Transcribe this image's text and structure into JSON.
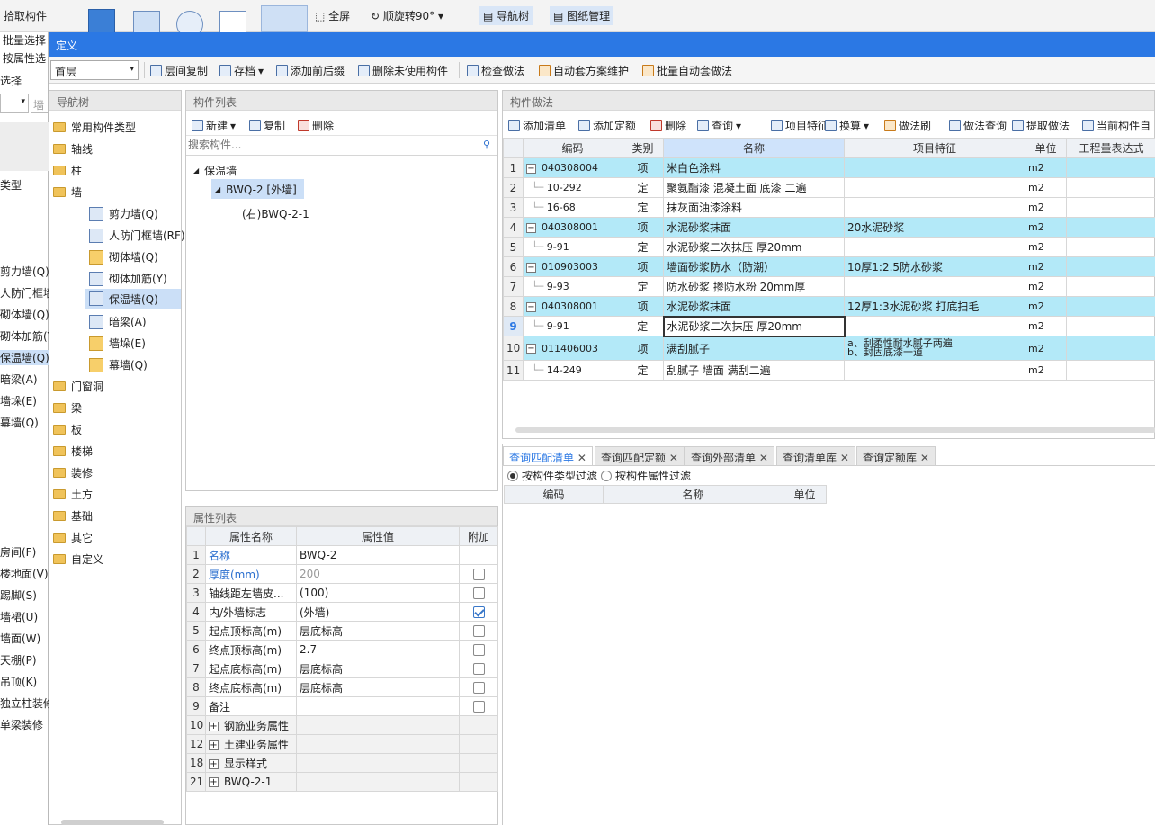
{
  "ribbon": {
    "pick_component": "拾取构件",
    "batch_select": "批量选择",
    "select_by_attr": "按属性选",
    "select": "选择",
    "fullscreen": "全屏",
    "rotate_cw": "顺旋转90°",
    "nav_tree": "导航树",
    "drawing_mgmt": "图纸管理"
  },
  "left_strip": {
    "combo_text": "墙",
    "type_label": "类型",
    "items": [
      "剪力墙(Q)",
      "人防门框墙",
      "砌体墙(Q)",
      "砌体加筋(Y",
      "保温墙(Q)",
      "暗梁(A)",
      "墙垛(E)",
      "幕墙(Q)"
    ],
    "items2": [
      "房间(F)",
      "楼地面(V)",
      "踢脚(S)",
      "墙裙(U)",
      "墙面(W)",
      "天棚(P)",
      "吊顶(K)",
      "独立柱装修",
      "单梁装修"
    ]
  },
  "title": "定义",
  "toolbar": {
    "floor": "首层",
    "floor_copy": "层间复制",
    "save": "存档",
    "add_prefix_suffix": "添加前后缀",
    "delete_unused": "删除未使用构件",
    "check_method": "检查做法",
    "auto_plan": "自动套方案维护",
    "batch_auto": "批量自动套做法"
  },
  "nav_tree": {
    "title": "导航树",
    "items": [
      {
        "label": "常用构件类型"
      },
      {
        "label": "轴线"
      },
      {
        "label": "柱"
      },
      {
        "label": "墙"
      }
    ],
    "wall_children": [
      "剪力墙(Q)",
      "人防门框墙(RF)",
      "砌体墙(Q)",
      "砌体加筋(Y)",
      "保温墙(Q)",
      "暗梁(A)",
      "墙垛(E)",
      "幕墙(Q)"
    ],
    "items_after": [
      "门窗洞",
      "梁",
      "板",
      "楼梯",
      "装修",
      "土方",
      "基础",
      "其它",
      "自定义"
    ]
  },
  "component_list": {
    "title": "构件列表",
    "new": "新建",
    "copy": "复制",
    "delete": "删除",
    "search_placeholder": "搜索构件...",
    "root": "保温墙",
    "child": "BWQ-2 [外墙]",
    "grandchild": "(右)BWQ-2-1"
  },
  "property_list": {
    "title": "属性列表",
    "headers": [
      "属性名称",
      "属性值",
      "附加"
    ],
    "rows": [
      {
        "no": "1",
        "name": "名称",
        "value": "BWQ-2",
        "check": "none"
      },
      {
        "no": "2",
        "name": "厚度(mm)",
        "value": "200",
        "check": "off"
      },
      {
        "no": "3",
        "name": "轴线距左墙皮...",
        "value": "(100)",
        "check": "off"
      },
      {
        "no": "4",
        "name": "内/外墙标志",
        "value": "(外墙)",
        "check": "on"
      },
      {
        "no": "5",
        "name": "起点顶标高(m)",
        "value": "层底标高",
        "check": "off"
      },
      {
        "no": "6",
        "name": "终点顶标高(m)",
        "value": "2.7",
        "check": "off"
      },
      {
        "no": "7",
        "name": "起点底标高(m)",
        "value": "层底标高",
        "check": "off"
      },
      {
        "no": "8",
        "name": "终点底标高(m)",
        "value": "层底标高",
        "check": "off"
      },
      {
        "no": "9",
        "name": "备注",
        "value": "",
        "check": "off"
      },
      {
        "no": "10",
        "name": "钢筋业务属性",
        "value": "",
        "check": "group"
      },
      {
        "no": "12",
        "name": "土建业务属性",
        "value": "",
        "check": "group"
      },
      {
        "no": "18",
        "name": "显示样式",
        "value": "",
        "check": "group"
      },
      {
        "no": "21",
        "name": "BWQ-2-1",
        "value": "",
        "check": "group"
      }
    ]
  },
  "method": {
    "title": "构件做法",
    "toolbar": [
      "添加清单",
      "添加定额",
      "删除",
      "查询",
      "项目特征",
      "换算",
      "做法刷",
      "做法查询",
      "提取做法",
      "当前构件自"
    ],
    "headers": [
      "编码",
      "类别",
      "名称",
      "项目特征",
      "单位",
      "工程量表达式"
    ],
    "rows": [
      {
        "no": "1",
        "code": "040308004",
        "type": "项",
        "name": "米白色涂料",
        "feature": "",
        "unit": "m2",
        "lvl": "item"
      },
      {
        "no": "2",
        "code": "10-292",
        "type": "定",
        "name": "聚氨酯漆 混凝土面 底漆 二遍",
        "feature": "",
        "unit": "m2",
        "lvl": "sub"
      },
      {
        "no": "3",
        "code": "16-68",
        "type": "定",
        "name": "抹灰面油漆涂料",
        "feature": "",
        "unit": "m2",
        "lvl": "sub"
      },
      {
        "no": "4",
        "code": "040308001",
        "type": "项",
        "name": "水泥砂浆抹面",
        "feature": "20水泥砂浆",
        "unit": "m2",
        "lvl": "item"
      },
      {
        "no": "5",
        "code": "9-91",
        "type": "定",
        "name": "水泥砂浆二次抹压 厚20mm",
        "feature": "",
        "unit": "m2",
        "lvl": "sub"
      },
      {
        "no": "6",
        "code": "010903003",
        "type": "项",
        "name": "墙面砂浆防水（防潮）",
        "feature": "10厚1:2.5防水砂浆",
        "unit": "m2",
        "lvl": "item"
      },
      {
        "no": "7",
        "code": "9-93",
        "type": "定",
        "name": "防水砂浆 掺防水粉 20mm厚",
        "feature": "",
        "unit": "m2",
        "lvl": "sub"
      },
      {
        "no": "8",
        "code": "040308001",
        "type": "项",
        "name": "水泥砂浆抹面",
        "feature": "12厚1:3水泥砂浆 打底扫毛",
        "unit": "m2",
        "lvl": "item"
      },
      {
        "no": "9",
        "code": "9-91",
        "type": "定",
        "name": "水泥砂浆二次抹压 厚20mm",
        "feature": "",
        "unit": "m2",
        "lvl": "sub"
      },
      {
        "no": "10",
        "code": "011406003",
        "type": "项",
        "name": "满刮腻子",
        "feature": "a、刮柔性耐水腻子两遍",
        "feature2": "b、封固底漆一道",
        "unit": "m2",
        "lvl": "item"
      },
      {
        "no": "11",
        "code": "14-249",
        "type": "定",
        "name": "刮腻子 墙面 满刮二遍",
        "feature": "",
        "unit": "m2",
        "lvl": "sub"
      }
    ]
  },
  "query_tabs": [
    "查询匹配清单",
    "查询匹配定额",
    "查询外部清单",
    "查询清单库",
    "查询定额库"
  ],
  "filter": {
    "by_type": "按构件类型过滤",
    "by_attr": "按构件属性过滤"
  },
  "query_headers": [
    "编码",
    "名称",
    "单位"
  ],
  "colors": {
    "accent": "#2b78e4",
    "highlight": "#b3e9f8",
    "selection": "#cbdff7"
  }
}
